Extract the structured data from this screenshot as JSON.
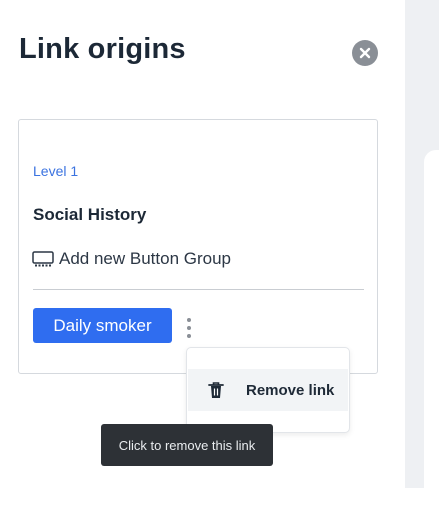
{
  "panel": {
    "title": "Link origins",
    "close_icon": "close-x-icon"
  },
  "card": {
    "level_label": "Level 1",
    "section_title": "Social History",
    "add_group": {
      "icon": "keyboard-icon",
      "label": "Add new Button Group"
    },
    "option_button": "Daily smoker",
    "more_icon": "kebab-vertical-icon"
  },
  "context_menu": {
    "items": [
      {
        "icon": "trash-icon",
        "label": "Remove link"
      }
    ]
  },
  "tooltip": {
    "text": "Click to remove this link"
  },
  "colors": {
    "accent": "#2f6df0",
    "level_text": "#3b73e0",
    "close_button": "#8a8f96",
    "tooltip_bg": "#2d3136"
  }
}
